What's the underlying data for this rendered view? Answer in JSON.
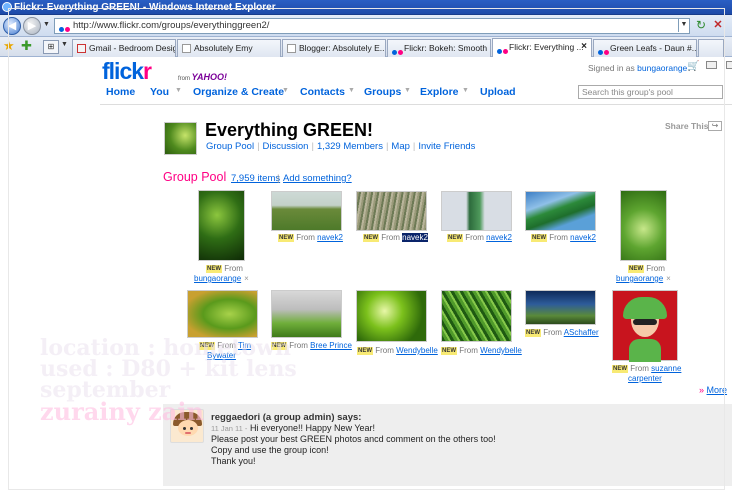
{
  "browser": {
    "title": "Flickr: Everything GREEN! - Windows Internet Explorer",
    "url": "http://www.flickr.com/groups/everythinggreen2/",
    "tabs": [
      {
        "label": "Gmail - Bedroom Desig...",
        "icon": "gmail-icon"
      },
      {
        "label": "Absolutely Emy",
        "icon": "page-icon"
      },
      {
        "label": "Blogger: Absolutely E...",
        "icon": "blogger-icon"
      },
      {
        "label": "Flickr: Bokeh: Smooth ...",
        "icon": "flickr-icon"
      },
      {
        "label": "Flickr: Everything ...",
        "icon": "flickr-icon",
        "active": true
      },
      {
        "label": "Green Leafs - Daun #...",
        "icon": "flickr-icon"
      }
    ],
    "close_tab_glyph": "×"
  },
  "header": {
    "logo_part1": "flick",
    "logo_part2": "r",
    "logo_from": "from",
    "logo_yahoo": "YAHOO!",
    "signed_in_prefix": "Signed in as",
    "signed_in_user": "bungaorange",
    "search_placeholder": "Search this group's pool"
  },
  "nav": {
    "items": [
      {
        "label": "Home"
      },
      {
        "label": "You"
      },
      {
        "label": "Organize & Create"
      },
      {
        "label": "Contacts"
      },
      {
        "label": "Groups"
      },
      {
        "label": "Explore"
      },
      {
        "label": "Upload"
      }
    ],
    "dropdown_glyph": "▼"
  },
  "group": {
    "title": "Everything GREEN!",
    "links": [
      "Group Pool",
      "Discussion",
      "1,329 Members",
      "Map",
      "Invite Friends"
    ],
    "share_label": "Share This"
  },
  "pool": {
    "heading": "Group Pool",
    "count": "7,959 items",
    "separator": "|",
    "add": "Add something?",
    "new_badge": "NEW",
    "from_label": "From",
    "remove_glyph": "×",
    "photos": [
      {
        "user": "bungaorange",
        "user2": ""
      },
      {
        "user": "navek2",
        "user2": ""
      },
      {
        "user": "navek2",
        "user2": ""
      },
      {
        "user": "navek2",
        "user2": ""
      },
      {
        "user": "navek2",
        "user2": ""
      },
      {
        "user": "bungaorange",
        "user2": ""
      },
      {
        "user": "Tim",
        "user2": "Bywater"
      },
      {
        "user": "Bree Prince",
        "user2": ""
      },
      {
        "user": "Wendybelle",
        "user2": ""
      },
      {
        "user": "Wendybelle",
        "user2": ""
      },
      {
        "user": "ASchaffer",
        "user2": ""
      },
      {
        "user": "suzanne",
        "user2": "carpenter"
      }
    ],
    "more_arrows": "»",
    "more_label": "More"
  },
  "admin_note": {
    "author_line": "reggaedori (a group admin) says:",
    "date": "11 Jan 11 -",
    "line1": "Hi everyone!! Happy New Year!",
    "line2": "Please post your best GREEN photos ancd comment on the others too!",
    "line3": "Copy and use the group icon!",
    "line4": "Thank you!"
  },
  "watermark": {
    "line1": "location : hometown",
    "line2": "used : D80 + kit lens",
    "line3": "september",
    "line4": "zurainy zain"
  },
  "colors": {
    "flickr_blue": "#0063dc",
    "flickr_pink": "#ff0084",
    "ie_titlebar": "#2a5fc4"
  }
}
